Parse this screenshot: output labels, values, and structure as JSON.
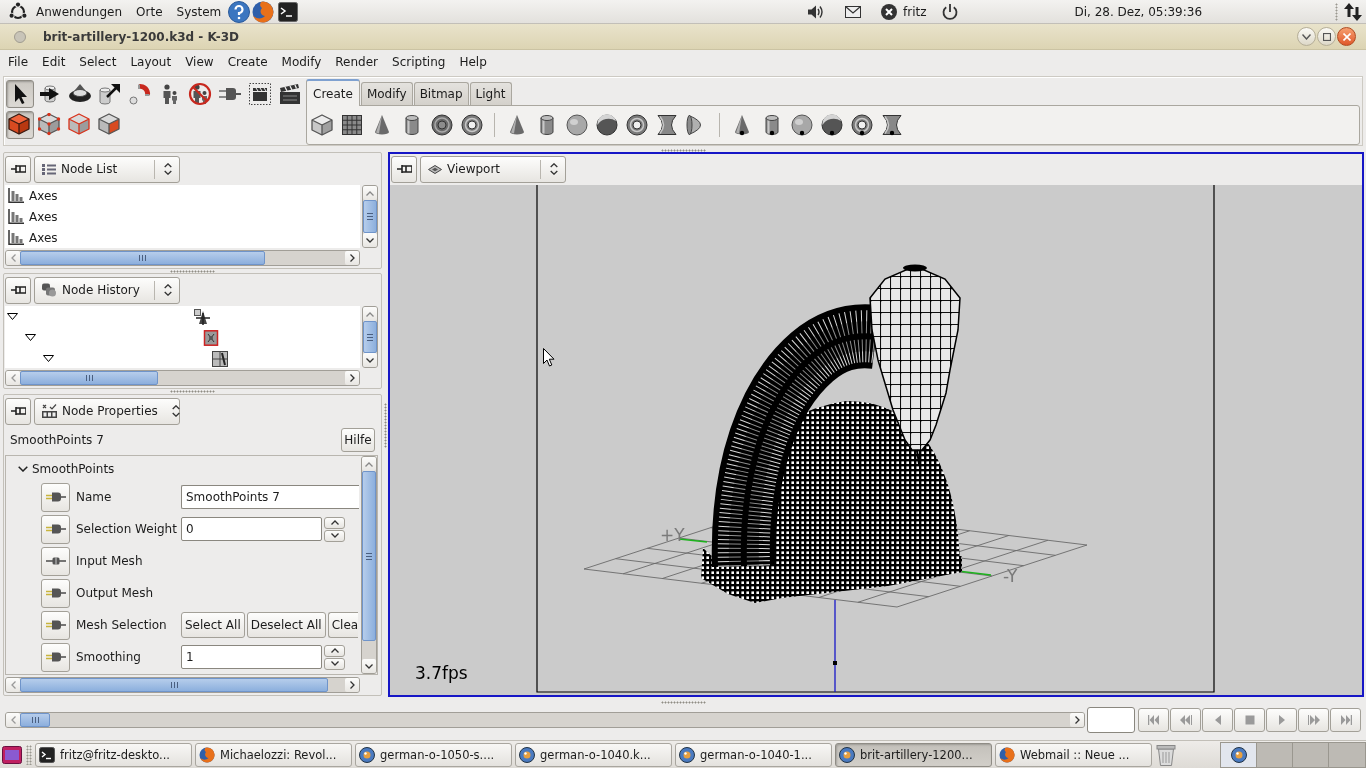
{
  "top_panel": {
    "menus": [
      "Anwendungen",
      "Orte",
      "System"
    ],
    "user": "fritz",
    "clock": "Di, 28. Dez, 05:39:36"
  },
  "window": {
    "title": "brit-artillery-1200.k3d - K-3D"
  },
  "menu_bar": [
    "File",
    "Edit",
    "Select",
    "Layout",
    "View",
    "Create",
    "Modify",
    "Render",
    "Scripting",
    "Help"
  ],
  "tools": [
    {
      "kind": "select",
      "selected": true
    },
    {
      "kind": "move",
      "selected": false
    },
    {
      "kind": "rotate",
      "selected": false
    },
    {
      "kind": "scale",
      "selected": false
    },
    {
      "kind": "snap",
      "selected": false
    },
    {
      "kind": "parent",
      "selected": false
    },
    {
      "kind": "unparent",
      "selected": false
    },
    {
      "kind": "plugin",
      "selected": false
    },
    {
      "kind": "render-frame",
      "selected": false
    },
    {
      "kind": "render-animation",
      "selected": false
    }
  ],
  "selection_modes": [
    {
      "kind": "object",
      "selected": true
    },
    {
      "kind": "point",
      "selected": false
    },
    {
      "kind": "edge",
      "selected": false
    },
    {
      "kind": "face",
      "selected": false
    }
  ],
  "tabs": [
    {
      "label": "Create",
      "selected": true
    },
    {
      "label": "Modify",
      "selected": false
    },
    {
      "label": "Bitmap",
      "selected": false
    },
    {
      "label": "Light",
      "selected": false
    }
  ],
  "node_list": {
    "selector": "Node List",
    "items": [
      "Axes",
      "Axes",
      "Axes"
    ]
  },
  "node_history": {
    "selector": "Node History",
    "tree": [
      {
        "kind": "transform",
        "expanded": true,
        "children": [
          {
            "kind": "modifier",
            "expanded": true,
            "children": [
              {
                "kind": "source",
                "expanded": true
              }
            ]
          }
        ]
      }
    ]
  },
  "node_properties": {
    "selector": "Node Properties",
    "node": "SmoothPoints 7",
    "help_button": "Hilfe",
    "group": {
      "label": "SmoothPoints",
      "expanded": true,
      "properties": [
        {
          "kind": "text",
          "label": "Name",
          "value": "SmoothPoints 7",
          "connected": false
        },
        {
          "kind": "spin",
          "label": "Selection Weight",
          "value": "0",
          "connected": false
        },
        {
          "kind": "plain",
          "label": "Input Mesh",
          "connected": true
        },
        {
          "kind": "plain",
          "label": "Output Mesh",
          "connected": false
        },
        {
          "kind": "buttons",
          "label": "Mesh Selection",
          "buttons": [
            "Select All",
            "Deselect All",
            "Clea"
          ],
          "connected": false
        },
        {
          "kind": "spin",
          "label": "Smoothing",
          "value": "1",
          "connected": false
        }
      ]
    }
  },
  "viewport": {
    "selector": "Viewport",
    "axis_labels": [
      "+Y",
      "-Y"
    ],
    "fps": "3.7fps"
  },
  "taskbar": {
    "tasks": [
      {
        "kind": "terminal",
        "label": "fritz@fritz-deskto...",
        "selected": false
      },
      {
        "kind": "browser",
        "label": "Michaelozzi: Revol...",
        "selected": false
      },
      {
        "kind": "k3d",
        "label": "german-o-1050-s....",
        "selected": false
      },
      {
        "kind": "k3d",
        "label": "german-o-1040.k...",
        "selected": false
      },
      {
        "kind": "k3d",
        "label": "german-o-1040-1...",
        "selected": false
      },
      {
        "kind": "k3d",
        "label": "brit-artillery-1200...",
        "selected": true
      },
      {
        "kind": "browser",
        "label": "Webmail :: Neue ...",
        "selected": false
      }
    ],
    "workspaces": [
      {
        "selected": true
      },
      {
        "selected": false
      },
      {
        "selected": false
      },
      {
        "selected": false
      }
    ]
  }
}
